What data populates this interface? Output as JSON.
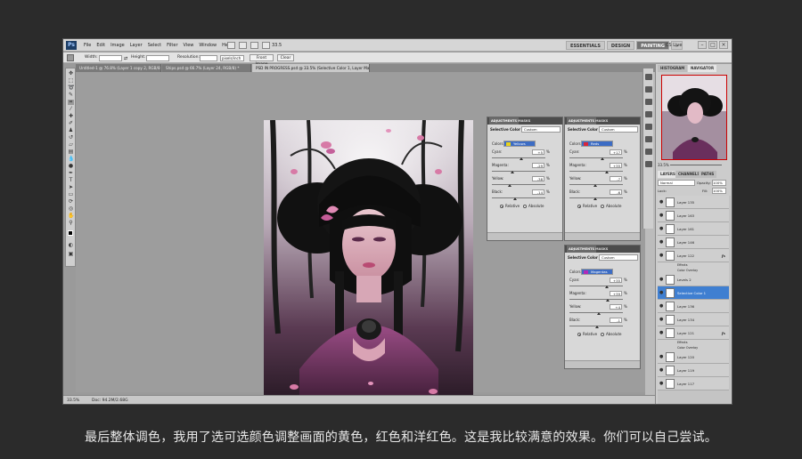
{
  "app": {
    "logo": "Ps",
    "menu": [
      "File",
      "Edit",
      "Image",
      "Layer",
      "Select",
      "Filter",
      "View",
      "Window",
      "Help"
    ],
    "zoom": "33.5",
    "workspaces": [
      "ESSENTIALS",
      "DESIGN",
      "PAINTING"
    ],
    "active_workspace": "PAINTING",
    "more": "»",
    "cslive": "CS Live",
    "window_controls": [
      "–",
      "□",
      "×"
    ]
  },
  "options_bar": {
    "width_label": "Width:",
    "height_label": "Height:",
    "resolution_label": "Resolution:",
    "resolution_unit": "pixels/inch",
    "front_image": "Front Image",
    "clear": "Clear"
  },
  "tabs": [
    "Untitled-1 @ 76.8% (Layer 1 copy 2, RGB/8) *",
    "Ships.psd @ 66.7% (Layer 24, RGB/8) *",
    "PSD IN PROGRESS.psd @ 33.5% (Selective Color 1, Layer Mask/8) *"
  ],
  "status": {
    "zoom": "33.5%",
    "doc": "Doc: 94.2M/2.68G"
  },
  "adjustments": [
    {
      "tab_active": "ADJUSTMENTS",
      "tab_other": "MASKS",
      "title": "Selective Color",
      "preset": "Custom",
      "colors_label": "Colors:",
      "color_name": "Yellows",
      "color_hex": "#e8d21a",
      "sliders": [
        {
          "label": "Cyan:",
          "value": "+5"
        },
        {
          "label": "Magenta:",
          "value": "-29"
        },
        {
          "label": "Yellow:",
          "value": "-38"
        },
        {
          "label": "Black:",
          "value": "-14"
        }
      ],
      "relative": "Relative",
      "absolute": "Absolute"
    },
    {
      "tab_active": "ADJUSTMENTS",
      "tab_other": "MASKS",
      "title": "Selective Color",
      "preset": "Custom",
      "colors_label": "Colors:",
      "color_name": "Reds",
      "color_hex": "#d8253a",
      "sliders": [
        {
          "label": "Cyan:",
          "value": "+17"
        },
        {
          "label": "Magenta:",
          "value": "+35"
        },
        {
          "label": "Yellow:",
          "value": "-7"
        },
        {
          "label": "Black:",
          "value": "-6"
        }
      ],
      "relative": "Relative",
      "absolute": "Absolute"
    },
    {
      "tab_active": "ADJUSTMENTS",
      "tab_other": "MASKS",
      "title": "Selective Color",
      "preset": "Custom",
      "colors_label": "Colors:",
      "color_name": "Magentas",
      "color_hex": "#b02ab8",
      "sliders": [
        {
          "label": "Cyan:",
          "value": "+35"
        },
        {
          "label": "Magenta:",
          "value": "+39"
        },
        {
          "label": "Yellow:",
          "value": "+4"
        },
        {
          "label": "Black:",
          "value": "-1"
        }
      ],
      "relative": "Relative",
      "absolute": "Absolute"
    }
  ],
  "navigator": {
    "tabs": [
      "HISTOGRAM",
      "NAVIGATOR"
    ],
    "zoom": "33.5%"
  },
  "layers_panel": {
    "tabs": [
      "LAYERS",
      "CHANNELS",
      "PATHS"
    ],
    "blend": "Normal",
    "opacity_label": "Opacity:",
    "opacity": "100%",
    "lock_label": "Lock:",
    "fill_label": "Fill:",
    "fill": "100%",
    "rows": [
      {
        "name": "Layer 135",
        "fx": ""
      },
      {
        "name": "Layer 163",
        "fx": ""
      },
      {
        "name": "Layer 161",
        "fx": ""
      },
      {
        "name": "Layer 146",
        "fx": ""
      },
      {
        "name": "Layer 122",
        "fx": "fx"
      },
      {
        "name": "Effects",
        "sub": true
      },
      {
        "name": "Color Overlay",
        "sub": true
      },
      {
        "name": "Levels 2",
        "fx": ""
      },
      {
        "name": "Selective Color 1",
        "fx": "",
        "selected": true
      },
      {
        "name": "Layer 136",
        "fx": ""
      },
      {
        "name": "Layer 134",
        "fx": ""
      },
      {
        "name": "Layer 121",
        "fx": "fx"
      },
      {
        "name": "Effects",
        "sub": true
      },
      {
        "name": "Color Overlay",
        "sub": true
      },
      {
        "name": "Layer 120",
        "fx": ""
      },
      {
        "name": "Layer 119",
        "fx": ""
      },
      {
        "name": "Layer 117",
        "fx": ""
      }
    ]
  },
  "caption": "最后整体调色，我用了选可选颜色调整画面的黄色，红色和洋红色。这是我比较满意的效果。你们可以自己尝试。"
}
